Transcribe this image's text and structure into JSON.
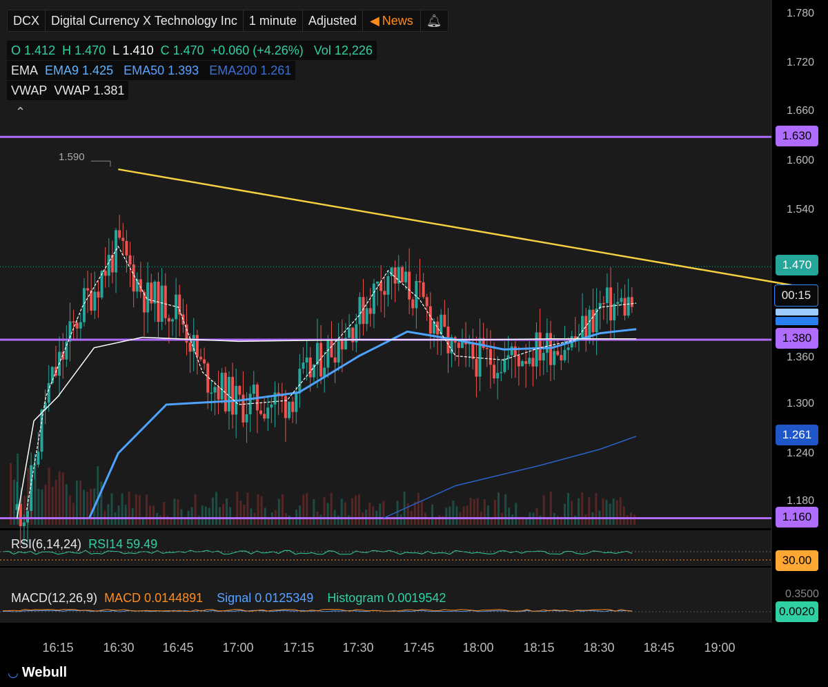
{
  "header": {
    "ticker": "DCX",
    "company": "Digital Currency X Technology Inc",
    "interval": "1 minute",
    "adjust": "Adjusted",
    "news": "News"
  },
  "ohlc": {
    "o_label": "O",
    "o": "1.412",
    "h_label": "H",
    "h": "1.470",
    "l_label": "L",
    "l": "1.410",
    "c_label": "C",
    "c": "1.470",
    "change": "+0.060 (+4.26%)",
    "vol_label": "Vol",
    "vol": "12,226"
  },
  "ema": {
    "label": "EMA",
    "ema9": "EMA9 1.425",
    "ema50": "EMA50 1.393",
    "ema200": "EMA200 1.261"
  },
  "vwap": {
    "label": "VWAP",
    "value": "VWAP 1.381"
  },
  "rsi": {
    "label": "RSI(6,14,24)",
    "value": "RSI14 59.49",
    "tag": "30.00"
  },
  "macd": {
    "label": "MACD(12,26,9)",
    "macd": "MACD 0.0144891",
    "signal": "Signal 0.0125349",
    "hist": "Histogram 0.0019542",
    "tag": "0.0020",
    "axis_top": "0.3500"
  },
  "price_tags": {
    "resistance": "1.630",
    "last": "1.470",
    "countdown": "00:15",
    "support": "1.380",
    "ema200": "1.261",
    "support_low": "1.160"
  },
  "high_marker": "1.590",
  "brand": "Webull",
  "colors": {
    "up": "#26a69a",
    "down": "#ef5350",
    "trend": "#f5d142",
    "level": "#b06cff",
    "ema9": "#ffffff",
    "vwap": "#ffffff",
    "ema50": "#4da3ff",
    "ema200": "#2a63c9"
  },
  "chart_data": {
    "type": "candlestick",
    "ylim": [
      1.16,
      1.79
    ],
    "yticks": [
      "1.780",
      "1.720",
      "1.660",
      "1.600",
      "1.540",
      "1.360",
      "1.300",
      "1.240",
      "1.180"
    ],
    "xticks": [
      "16:15",
      "16:30",
      "16:45",
      "17:00",
      "17:15",
      "17:30",
      "17:45",
      "18:00",
      "18:15",
      "18:30",
      "18:45",
      "19:00"
    ],
    "levels": [
      1.63,
      1.38,
      1.16
    ],
    "trendline": [
      [
        16.5,
        1.59
      ],
      [
        19.3,
        1.447
      ]
    ],
    "ema200_line": [
      [
        17.6,
        1.16
      ],
      [
        17.9,
        1.2
      ],
      [
        18.25,
        1.225
      ],
      [
        18.5,
        1.245
      ],
      [
        18.65,
        1.261
      ]
    ],
    "ema50_line": [
      [
        16.38,
        1.16
      ],
      [
        16.5,
        1.24
      ],
      [
        16.7,
        1.3
      ],
      [
        17.0,
        1.305
      ],
      [
        17.25,
        1.315
      ],
      [
        17.5,
        1.36
      ],
      [
        17.7,
        1.39
      ],
      [
        17.9,
        1.38
      ],
      [
        18.1,
        1.368
      ],
      [
        18.3,
        1.37
      ],
      [
        18.5,
        1.388
      ],
      [
        18.65,
        1.393
      ]
    ],
    "vwap_line": [
      [
        16.08,
        1.16
      ],
      [
        16.15,
        1.28
      ],
      [
        16.25,
        1.31
      ],
      [
        16.4,
        1.37
      ],
      [
        16.6,
        1.383
      ],
      [
        17.0,
        1.378
      ],
      [
        17.5,
        1.38
      ],
      [
        18.0,
        1.38
      ],
      [
        18.3,
        1.381
      ],
      [
        18.65,
        1.381
      ]
    ],
    "ema9_line": [
      [
        16.12,
        1.17
      ],
      [
        16.2,
        1.31
      ],
      [
        16.35,
        1.42
      ],
      [
        16.5,
        1.495
      ],
      [
        16.62,
        1.43
      ],
      [
        16.75,
        1.42
      ],
      [
        16.85,
        1.34
      ],
      [
        17.0,
        1.3
      ],
      [
        17.2,
        1.305
      ],
      [
        17.35,
        1.36
      ],
      [
        17.5,
        1.41
      ],
      [
        17.62,
        1.465
      ],
      [
        17.75,
        1.43
      ],
      [
        17.9,
        1.36
      ],
      [
        18.1,
        1.355
      ],
      [
        18.25,
        1.37
      ],
      [
        18.4,
        1.38
      ],
      [
        18.5,
        1.42
      ],
      [
        18.65,
        1.425
      ]
    ],
    "candles_summary": {
      "open": 1.412,
      "high": 1.47,
      "low": 1.41,
      "close": 1.47,
      "session_high": 1.59
    }
  }
}
